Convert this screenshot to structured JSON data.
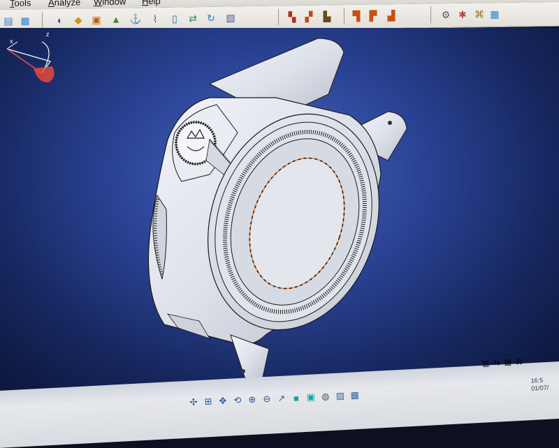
{
  "menu": {
    "items": [
      {
        "label": "Tools"
      },
      {
        "label": "Analyze"
      },
      {
        "label": "Window"
      },
      {
        "label": "Help"
      }
    ]
  },
  "toolbar": {
    "icons": [
      "sketcher-icon",
      "part-design-icon",
      "apply-material-icon",
      "generative-shape-icon",
      "cube-icon",
      "fill-icon",
      "anchor-icon",
      "paperclip-icon",
      "document-icon",
      "swap-icon",
      "rotate-arrows-icon",
      "sketch-plane-icon",
      "pad-icon",
      "pocket-icon",
      "shaft-icon",
      "hole-icon",
      "rib-icon",
      "slot-icon",
      "gear-tool-icon",
      "dress-up-icon",
      "thread-icon"
    ]
  },
  "bottom_toolbar": {
    "icons": [
      "fly-mode-icon",
      "fit-all-icon",
      "pan-icon",
      "rotate-view-icon",
      "zoom-in-icon",
      "zoom-out-icon",
      "normal-view-icon",
      "iso-view-icon",
      "view-mode-icon",
      "shading-icon",
      "hide-show-icon",
      "swap-visible-icon"
    ]
  },
  "status": {
    "clock_time": "16:5",
    "clock_date": "01/07/"
  },
  "compass": {
    "x_label": "x",
    "z_label": "z"
  },
  "colors": {
    "viewport_top": "#2c4599",
    "viewport_edge": "#0b1436",
    "part_fill": "#dfe3ec",
    "part_edge": "#1a1a1a",
    "highlight_edge": "#e8873a"
  }
}
